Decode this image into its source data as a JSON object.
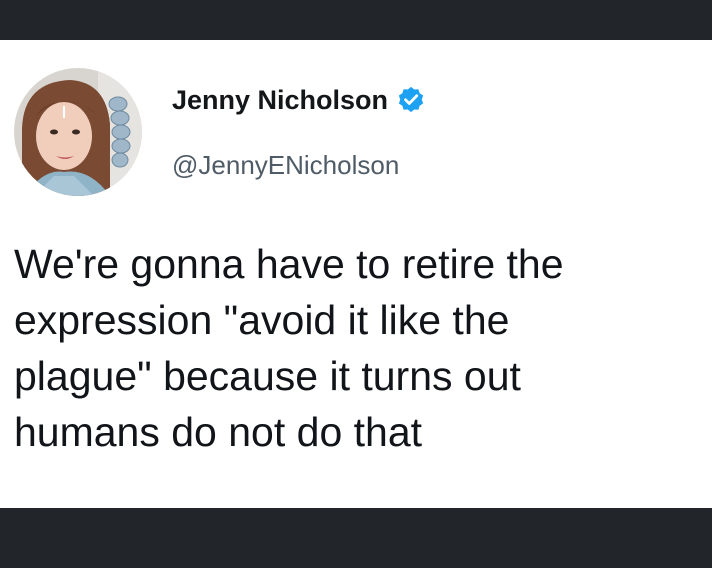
{
  "tweet": {
    "author": {
      "display_name": "Jenny Nicholson",
      "handle": "@JennyENicholson",
      "verified_icon": "verified-badge-icon",
      "verified_color": "#1da1f2"
    },
    "text_lines": [
      "We're gonna have to retire the",
      "expression \"avoid it like the",
      "plague\" because it turns out",
      "humans do not do that"
    ]
  },
  "colors": {
    "frame_background": "#22262b",
    "card_background": "#ffffff",
    "name_color": "#14171a",
    "handle_color": "#4f5b66",
    "text_color": "#111418"
  }
}
